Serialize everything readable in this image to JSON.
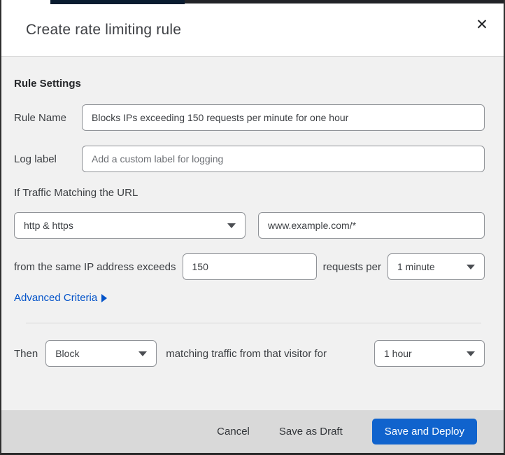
{
  "dialog": {
    "title": "Create rate limiting rule",
    "close_icon": "✕"
  },
  "rule_settings": {
    "heading": "Rule Settings",
    "rule_name": {
      "label": "Rule Name",
      "value": "Blocks IPs exceeding 150 requests per minute for one hour"
    },
    "log_label": {
      "label": "Log label",
      "placeholder": "Add a custom label for logging"
    }
  },
  "match": {
    "intro": "If Traffic Matching the URL",
    "scheme_select": {
      "value": "http & https"
    },
    "url_input": {
      "value": "www.example.com/*"
    },
    "exceeds_prefix": "from the same IP address exceeds",
    "threshold_input": {
      "value": "150"
    },
    "exceeds_mid": "requests per",
    "period_select": {
      "value": "1 minute"
    },
    "advanced_link": "Advanced Criteria"
  },
  "action": {
    "then_label": "Then",
    "action_select": {
      "value": "Block"
    },
    "mid_text": "matching traffic from that visitor for",
    "duration_select": {
      "value": "1 hour"
    }
  },
  "footer": {
    "cancel": "Cancel",
    "save_draft": "Save as Draft",
    "save_deploy": "Save and Deploy"
  },
  "colors": {
    "link_blue": "#0353c9",
    "button_blue": "#1063cd",
    "body_bg": "#f1f1f1",
    "footer_bg": "#d9d9d9"
  }
}
